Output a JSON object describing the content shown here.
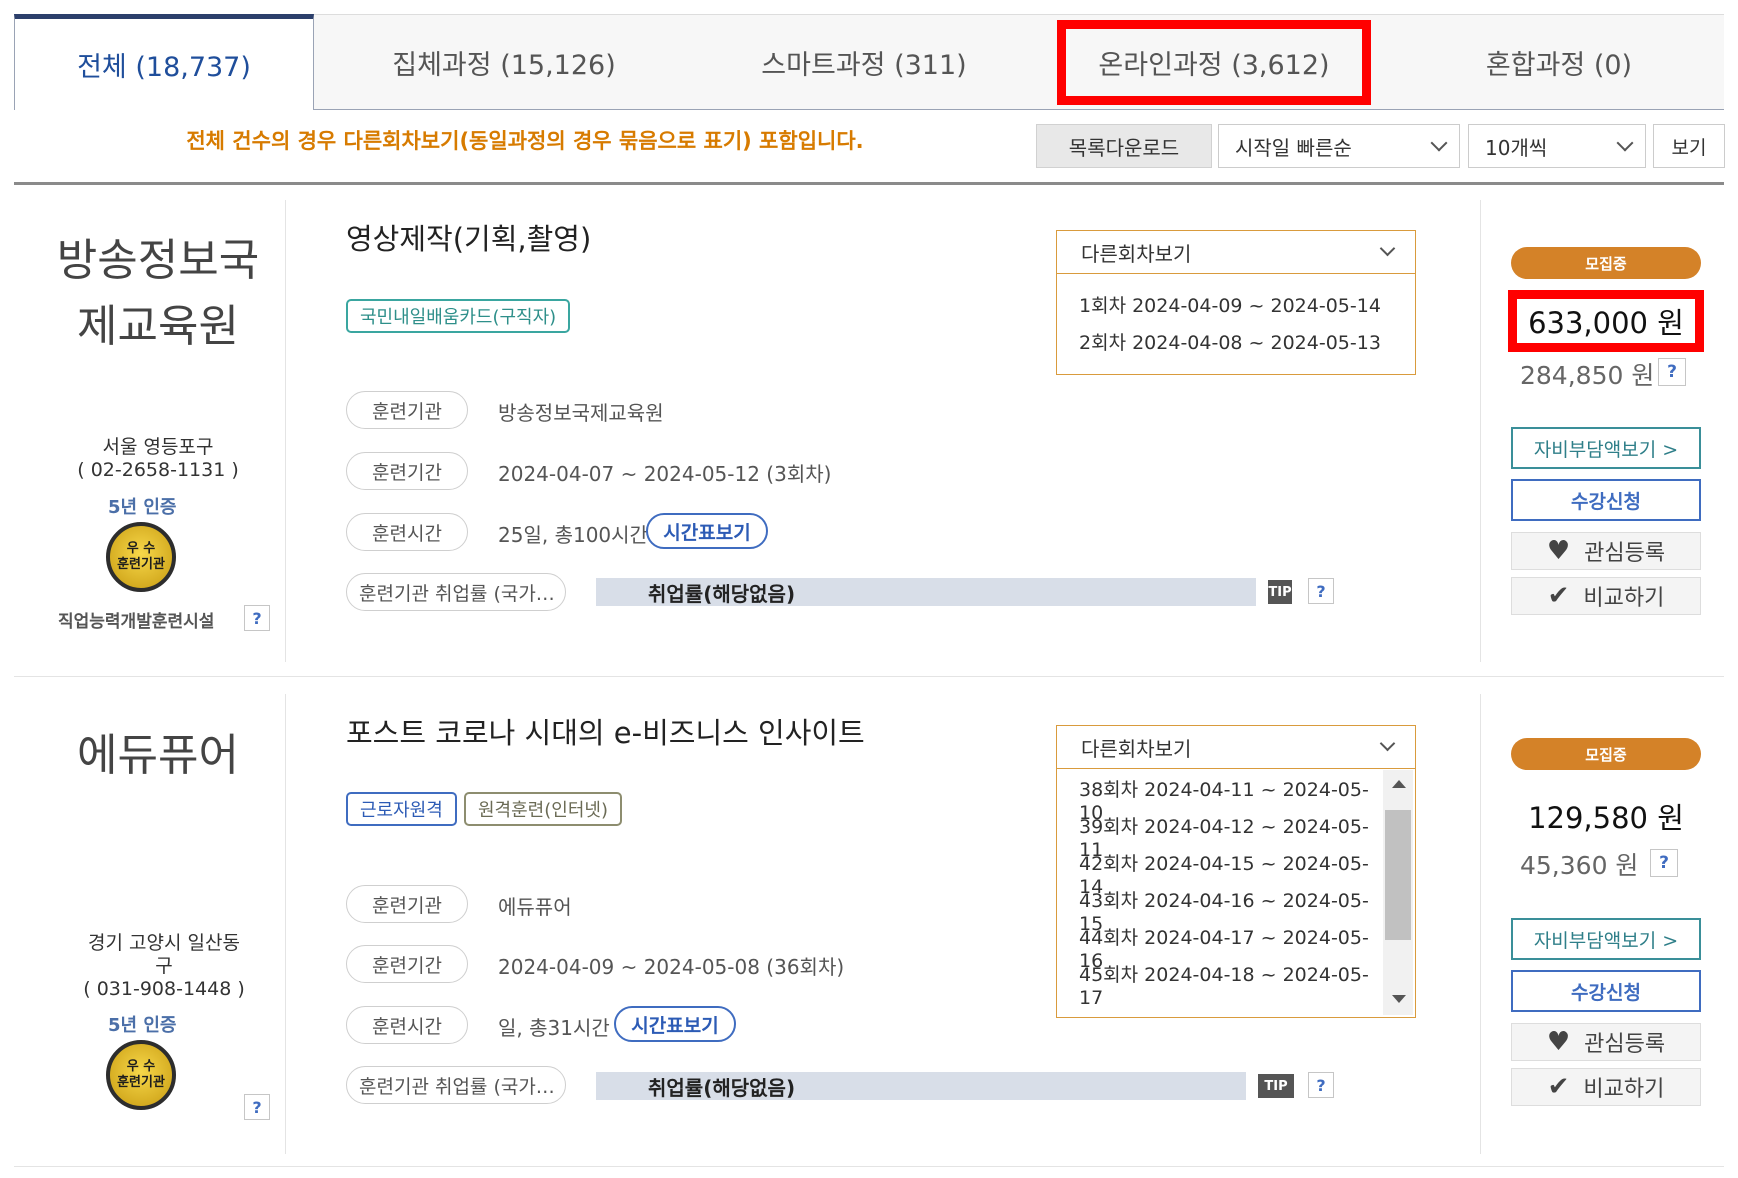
{
  "tabs": [
    {
      "label": "전체 (18,737)"
    },
    {
      "label": "집체과정 (15,126)"
    },
    {
      "label": "스마트과정 (311)"
    },
    {
      "label": "온라인과정 (3,612)"
    },
    {
      "label": "혼합과정 (0)"
    }
  ],
  "toolbar": {
    "notice": "전체 건수의 경우 다른회차보기(동일과정의 경우 묶음으로 표기) 포함입니다.",
    "download": "목록다운로드",
    "sort": "시작일 빠른순",
    "per_page": "10개씩",
    "view": "보기"
  },
  "labels": {
    "institution": "훈련기관",
    "period": "훈련기간",
    "hours": "훈련시간",
    "employment": "훈련기관 취업률 (국가…",
    "timetable": "시간표보기",
    "employment_bar": "취업률(해당없음)",
    "tip": "TIP",
    "other_rounds": "다른회차보기",
    "recruiting": "모집중",
    "self_pay": "자비부담액보기 >",
    "apply": "수강신청",
    "wish": "관심등록",
    "compare": "비교하기",
    "cert": "5년 인증",
    "badge_top": "우 수",
    "badge_bottom": "훈련기관",
    "help": "?"
  },
  "courses": [
    {
      "inst_line1": "방송정보국",
      "inst_line2": "제교육원",
      "location": "서울 영등포구",
      "phone": "( 02-2658-1131 )",
      "facility": "직업능력개발훈련시설",
      "title": "영상제작(기획,촬영)",
      "tags": [
        "국민내일배움카드(구직자)"
      ],
      "institution": "방송정보국제교육원",
      "period": "2024-04-07 ~ 2024-05-12 (3회차)",
      "hours": "25일, 총100시간",
      "rounds": [
        "1회차 2024-04-09 ~ 2024-05-14",
        "2회차 2024-04-08 ~ 2024-05-13"
      ],
      "price": "633,000 원",
      "self_price": "284,850 원"
    },
    {
      "inst_line1": "에듀퓨어",
      "location_line1": "경기 고양시 일산동",
      "location_line2": "구",
      "phone": "( 031-908-1448 )",
      "title": "포스트 코로나 시대의 e-비즈니스 인사이트",
      "tags": [
        "근로자원격",
        "원격훈련(인터넷)"
      ],
      "institution": "에듀퓨어",
      "period": "2024-04-09 ~ 2024-05-08 (36회차)",
      "hours": "일, 총31시간",
      "rounds": [
        "38회차 2024-04-11 ~ 2024-05-10",
        "39회차 2024-04-12 ~ 2024-05-11",
        "42회차 2024-04-15 ~ 2024-05-14",
        "43회차 2024-04-16 ~ 2024-05-15",
        "44회차 2024-04-17 ~ 2024-05-16",
        "45회차 2024-04-18 ~ 2024-05-17"
      ],
      "price": "129,580 원",
      "self_price": "45,360 원"
    }
  ],
  "colors": {
    "highlight": "#ff0000",
    "accent_orange": "#d48228",
    "tab_active": "#1f4e9b"
  }
}
